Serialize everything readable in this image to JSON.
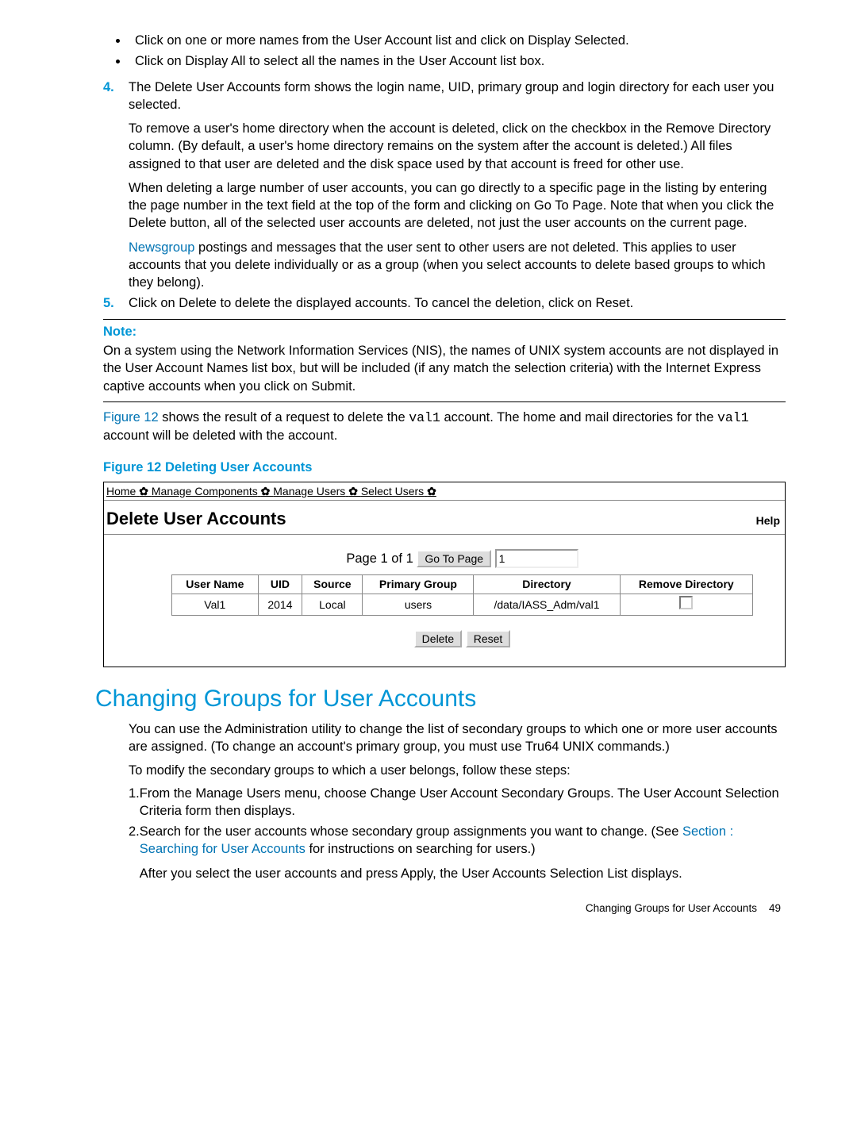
{
  "top_list": {
    "bullets": [
      "Click on one or more names from the User Account list and click on Display Selected.",
      "Click on Display All to select all the names in the User Account list box."
    ],
    "item4_num": "4.",
    "item4_p1": "The Delete User Accounts form shows the login name, UID, primary group and login directory for each user you selected.",
    "item4_p2": "To remove a user's home directory when the account is deleted, click on the checkbox in the Remove Directory column. (By default, a user's home directory remains on the system after the account is deleted.) All files assigned to that user are deleted and the disk space used by that account is freed for other use.",
    "item4_p3": "When deleting a large number of user accounts, you can go directly to a specific page in the listing by entering the page number in the text field at the top of the form and clicking on Go To Page. Note that when you click the Delete button, all of the selected user accounts are deleted, not just the user accounts on the current page.",
    "item4_p4_link": "Newsgroup",
    "item4_p4_rest": " postings and messages that the user sent to other users are not deleted. This applies to user accounts that you delete individually or as a group (when you select accounts to delete based groups to which they belong).",
    "item5_num": "5.",
    "item5_text": "Click on Delete to delete the displayed accounts. To cancel the deletion, click on Reset."
  },
  "note": {
    "head": "Note:",
    "body": "On a system using the Network Information Services (NIS), the names of UNIX system accounts are not displayed in the User Account Names list box, but will be included (if any match the selection criteria) with the Internet Express captive accounts when you click on Submit."
  },
  "after_note": {
    "link": "Figure 12",
    "mid1": " shows the result of a request to delete the ",
    "mono1": "val1",
    "mid2": " account. The home and mail directories for the ",
    "mono2": "val1",
    "tail": " account will be deleted with the account."
  },
  "fig": {
    "title": "Figure 12 Deleting User Accounts",
    "crumbs": {
      "home": "Home",
      "mc": "Manage Components",
      "mu": "Manage Users",
      "su": "Select Users"
    },
    "panel_title": "Delete User Accounts",
    "help": "Help",
    "page_label": "Page 1 of 1",
    "gotopage_btn": "Go To Page",
    "page_input": "1",
    "headers": {
      "user": "User Name",
      "uid": "UID",
      "source": "Source",
      "pgroup": "Primary Group",
      "dir": "Directory",
      "rdir": "Remove Directory"
    },
    "row": {
      "user": "Val1",
      "uid": "2014",
      "source": "Local",
      "pgroup": "users",
      "dir": "/data/IASS_Adm/val1"
    },
    "delete_btn": "Delete",
    "reset_btn": "Reset"
  },
  "section2": {
    "title": "Changing Groups for User Accounts",
    "p1": "You can use the Administration utility to change the list of secondary groups to which one or more user accounts are assigned. (To change an account's primary group, you must use Tru64 UNIX commands.)",
    "p2": "To modify the secondary groups to which a user belongs, follow these steps:",
    "it1_num": "1.",
    "it1": "From the Manage Users menu, choose Change User Account Secondary Groups. The User Account Selection Criteria form then displays.",
    "it2_num": "2.",
    "it2_a": "Search for the user accounts whose secondary group assignments you want to change. (See ",
    "it2_link": "Section : Searching for User Accounts",
    "it2_b": " for instructions on searching for users.)",
    "it2_p2": "After you select the user accounts and press Apply, the User Accounts Selection List displays."
  },
  "footer": {
    "label": "Changing Groups for User Accounts",
    "page": "49"
  }
}
